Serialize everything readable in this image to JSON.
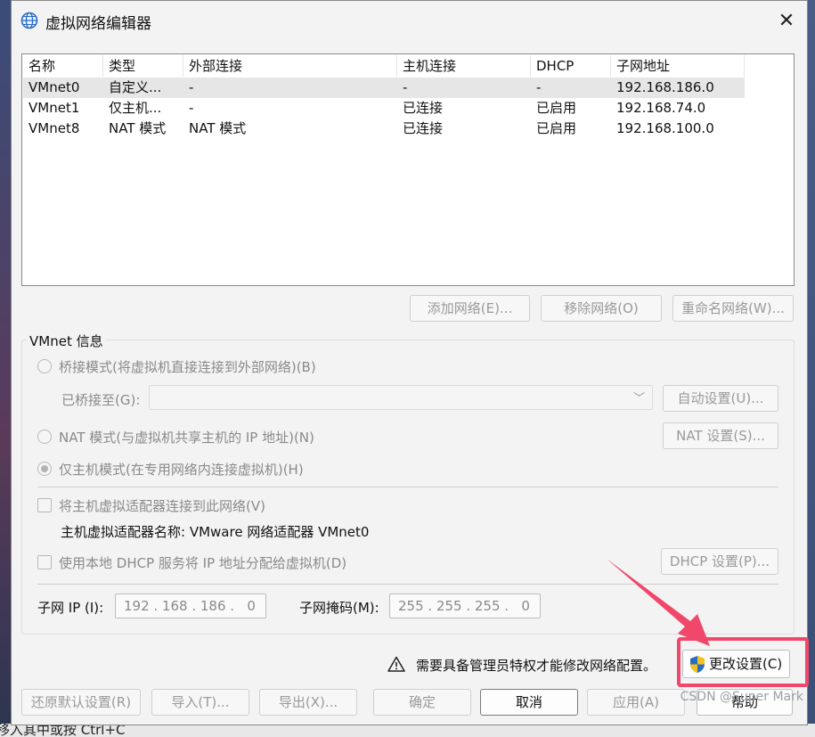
{
  "window": {
    "title": "虚拟网络编辑器"
  },
  "list": {
    "headers": [
      "名称",
      "类型",
      "外部连接",
      "主机连接",
      "DHCP",
      "子网地址"
    ],
    "rows": [
      [
        "VMnet0",
        "自定义...",
        "-",
        "-",
        "-",
        "192.168.186.0"
      ],
      [
        "VMnet1",
        "仅主机...",
        "-",
        "已连接",
        "已启用",
        "192.168.74.0"
      ],
      [
        "VMnet8",
        "NAT 模式",
        "NAT 模式",
        "已连接",
        "已启用",
        "192.168.100.0"
      ]
    ]
  },
  "list_buttons": {
    "add": "添加网络(E)...",
    "remove": "移除网络(O)",
    "rename": "重命名网络(W)..."
  },
  "vmnet_info": {
    "title": "VMnet 信息",
    "bridged_radio": "桥接模式(将虚拟机直接连接到外部网络)(B)",
    "bridged_to_label": "已桥接至(G):",
    "auto_settings": "自动设置(U)...",
    "nat_radio": "NAT 模式(与虚拟机共享主机的 IP 地址)(N)",
    "nat_settings": "NAT 设置(S)...",
    "hostonly_radio": "仅主机模式(在专用网络内连接虚拟机)(H)",
    "connect_adapter_check": "将主机虚拟适配器连接到此网络(V)",
    "adapter_name_label": "主机虚拟适配器名称: VMware 网络适配器 VMnet0",
    "use_dhcp_check": "使用本地 DHCP 服务将 IP 地址分配给虚拟机(D)",
    "dhcp_settings": "DHCP 设置(P)...",
    "subnet_ip_label": "子网 IP (I):",
    "subnet_ip_value": "192 . 168 . 186 .   0",
    "subnet_mask_label": "子网掩码(M):",
    "subnet_mask_value": "255 . 255 . 255 .   0"
  },
  "admin_notice": "需要具备管理员特权才能修改网络配置。",
  "change_settings": "更改设置(C)",
  "footer_buttons": {
    "restore": "还原默认设置(R)",
    "import": "导入(T)...",
    "export": "导出(X)...",
    "ok": "确定",
    "cancel": "取消",
    "apply": "应用(A)",
    "help": "帮助"
  },
  "watermark": "CSDN @Super Mark",
  "background_text": "移入其中或按 Ctrl+C",
  "colors": {
    "highlight": "#f0476a",
    "accent": "#2b6cc4"
  }
}
